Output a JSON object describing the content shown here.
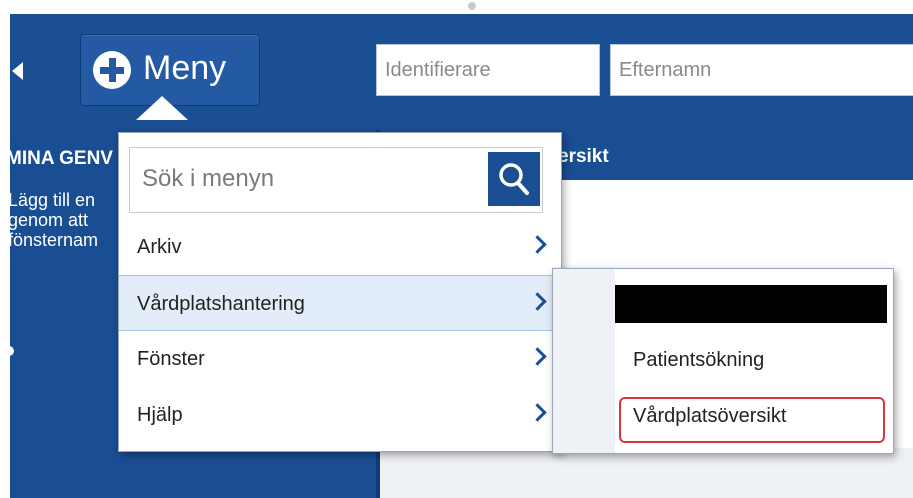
{
  "topbar": {
    "menu_label": "Meny",
    "identifier_placeholder": "Identifierare",
    "lastname_placeholder": "Efternamn"
  },
  "left_panel": {
    "heading": "MINA GENV",
    "lines": [
      "Lägg till en",
      "genom att",
      "fönsternam"
    ]
  },
  "right_panel": {
    "header_title": "ersikt"
  },
  "dropdown": {
    "search_placeholder": "Sök i menyn",
    "items": [
      {
        "label": "Arkiv",
        "active": false
      },
      {
        "label": "Vårdplatshantering",
        "active": true
      },
      {
        "label": "Fönster",
        "active": false
      },
      {
        "label": "Hjälp",
        "active": false
      }
    ]
  },
  "submenu": {
    "items": [
      "Patientsökning",
      "Vårdplatsöversikt"
    ]
  },
  "icons": {
    "back": "back-arrow-icon",
    "menu": "plus-circle-icon",
    "search": "search-icon",
    "chevron": "chevron-right-icon"
  },
  "colors": {
    "brand_blue": "#1b4f94",
    "active_item": "#e3edf9",
    "highlight": "#d9363e"
  }
}
